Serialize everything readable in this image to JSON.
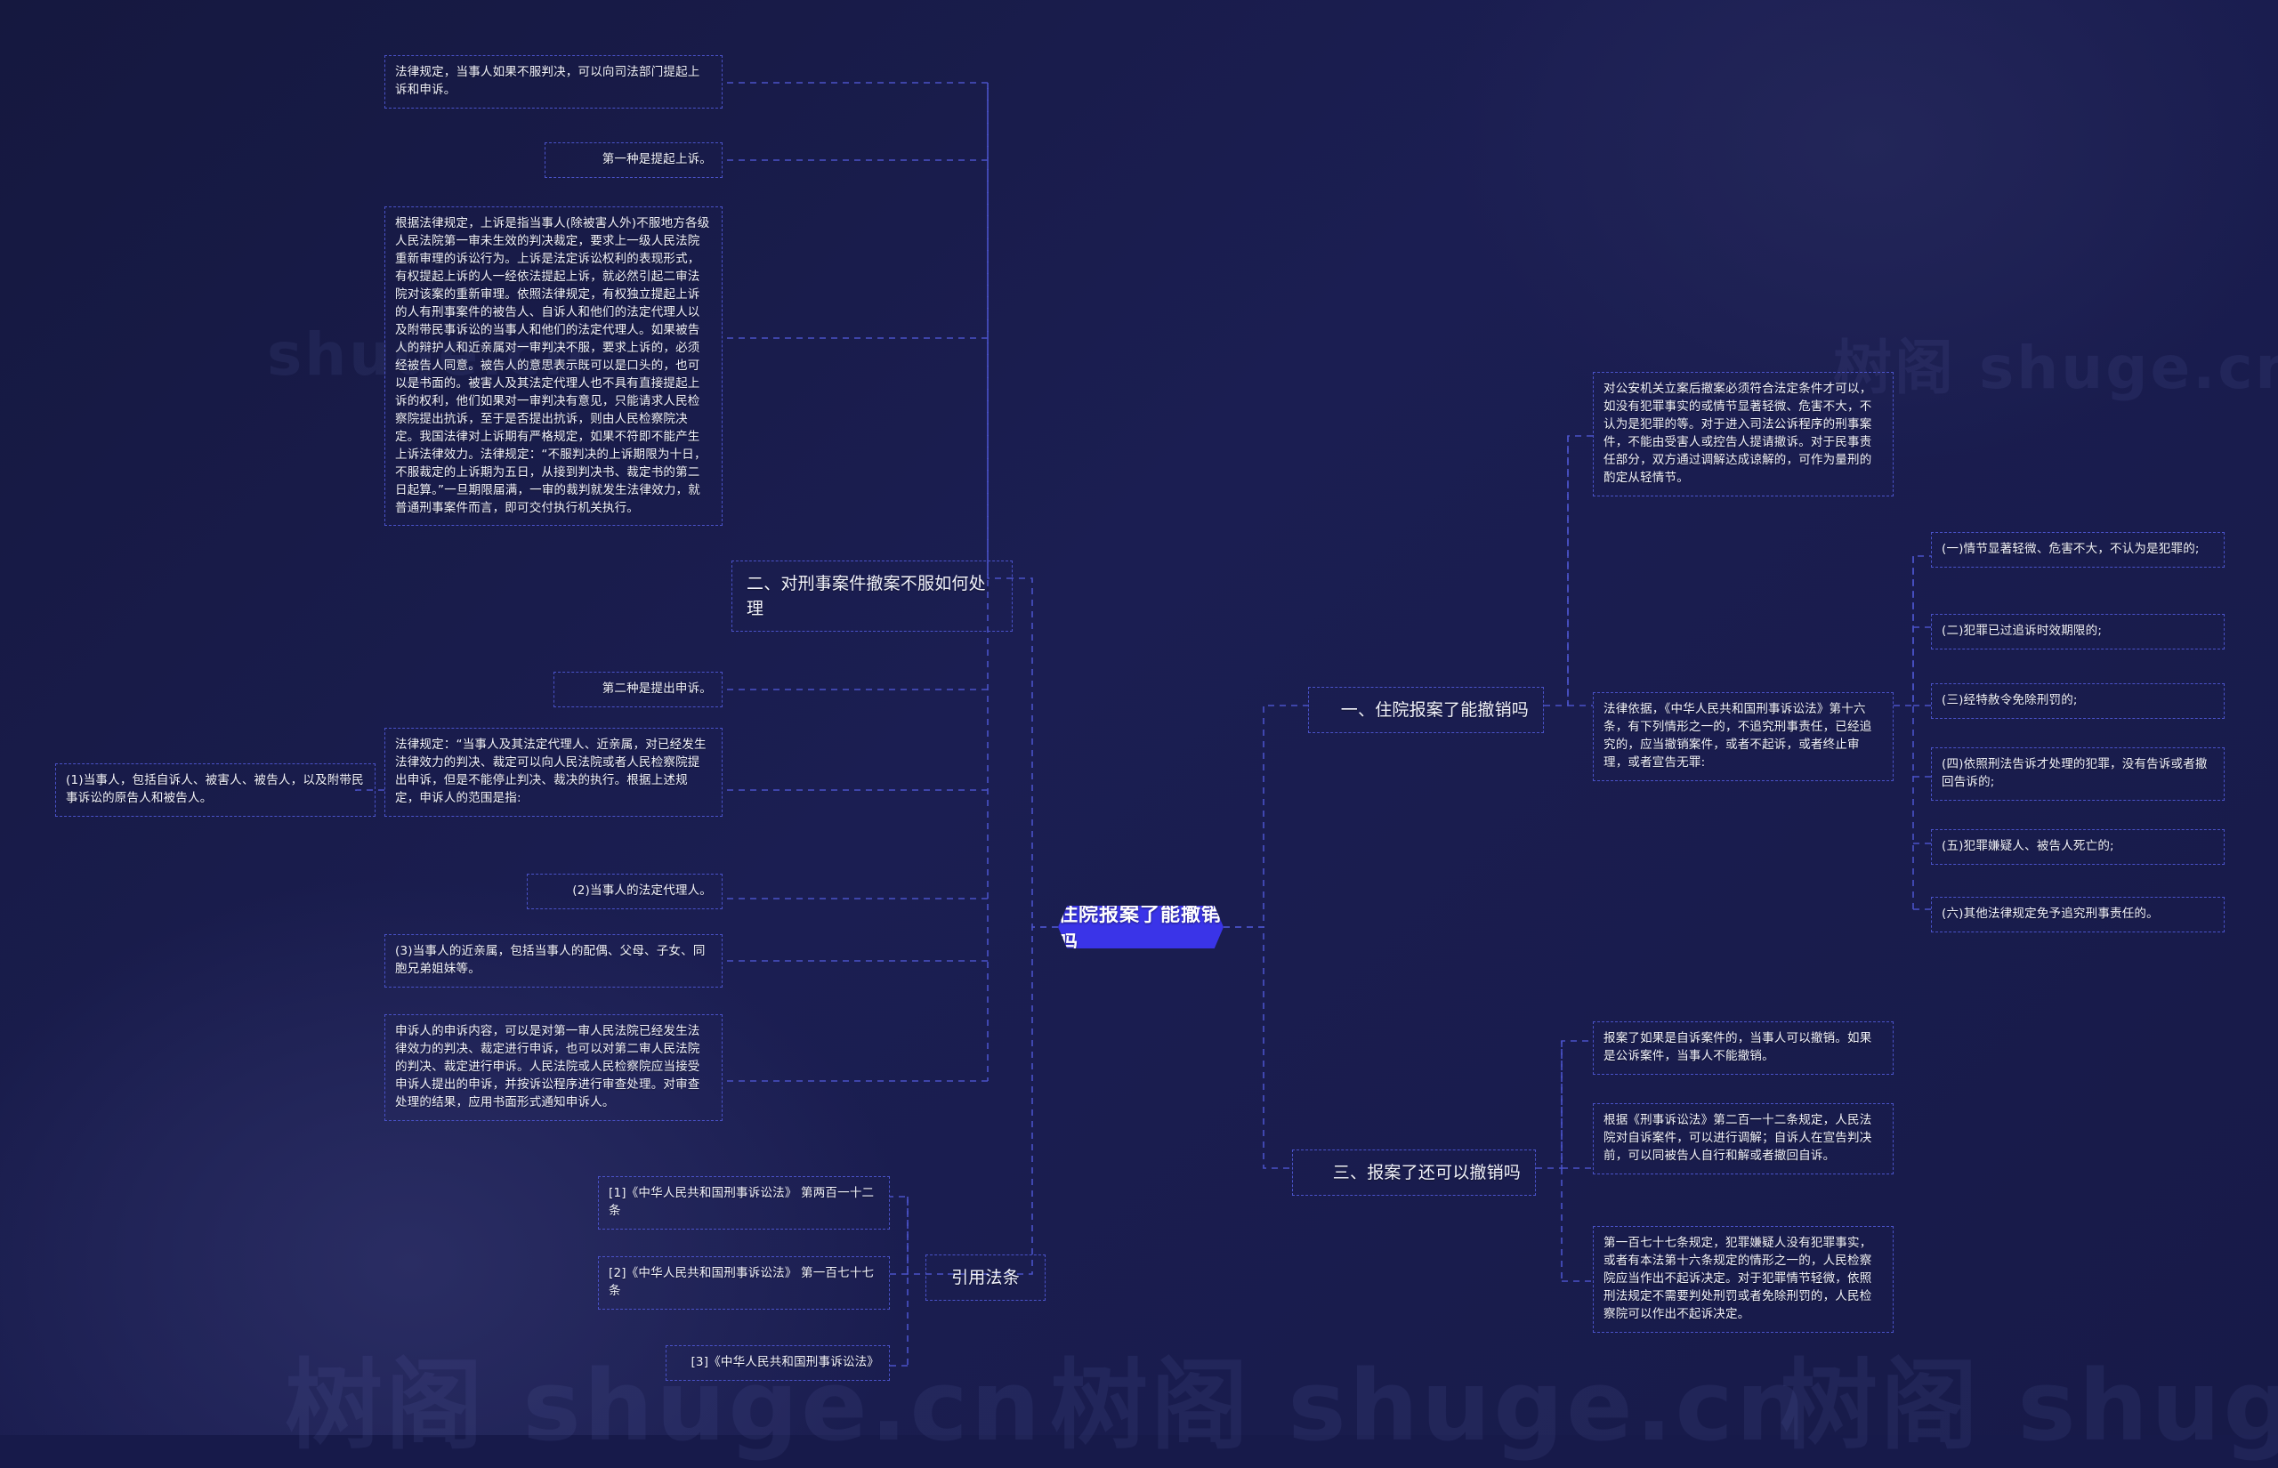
{
  "root": {
    "label": "住院报案了能撤销吗"
  },
  "theme": {
    "background": "#171a4a",
    "root_fill": "#3a34e8",
    "node_border": "#4a52c8",
    "text": "#f2f3fb"
  },
  "watermarks": [
    "树阁 shuge.cn",
    "树阁 shuge.cn",
    "树阁 shuge.cn",
    "shuge.cn",
    "树阁 shuge.cn"
  ],
  "branches": [
    {
      "id": "branch-1",
      "label": "一、住院报案了能撤销吗"
    },
    {
      "id": "branch-2",
      "label": "二、对刑事案件撤案不服如何处理"
    },
    {
      "id": "branch-3",
      "label": "三、报案了还可以撤销吗"
    },
    {
      "id": "branch-4",
      "label": "引用法条"
    }
  ],
  "nodes": {
    "n_top_intro": "法律规定，当事人如果不服判决，可以向司法部门提起上诉和申诉。",
    "n_first_kind": "第一种是提起上诉。",
    "n_appeal_body": "根据法律规定，上诉是指当事人(除被害人外)不服地方各级人民法院第一审未生效的判决裁定，要求上一级人民法院重新审理的诉讼行为。上诉是法定诉讼权利的表现形式，有权提起上诉的人一经依法提起上诉，就必然引起二审法院对该案的重新审理。依照法律规定，有权独立提起上诉的人有刑事案件的被告人、自诉人和他们的法定代理人以及附带民事诉讼的当事人和他们的法定代理人。如果被告人的辩护人和近亲属对一审判决不服，要求上诉的，必须经被告人同意。被告人的意思表示既可以是口头的，也可以是书面的。被害人及其法定代理人也不具有直接提起上诉的权利，他们如果对一审判决有意见，只能请求人民检察院提出抗诉，至于是否提出抗诉，则由人民检察院决定。我国法律对上诉期有严格规定，如果不符即不能产生上诉法律效力。法律规定：“不服判决的上诉期限为十日，不服裁定的上诉期为五日，从接到判决书、裁定书的第二日起算。”一旦期限届满，一审的裁判就发生法律效力，就普通刑事案件而言，即可交付执行机关执行。",
    "n_second_kind": "第二种是提出申诉。",
    "n_appeal2_body": "法律规定：“当事人及其法定代理人、近亲属，对已经发生法律效力的判决、裁定可以向人民法院或者人民检察院提出申诉，但是不能停止判决、裁决的执行。根据上述规定，申诉人的范围是指:",
    "n_party_1": "(1)当事人，包括自诉人、被害人、被告人，以及附带民事诉讼的原告人和被告人。",
    "n_party_2": "(2)当事人的法定代理人。",
    "n_party_3": "(3)当事人的近亲属，包括当事人的配偶、父母、子女、同胞兄弟姐妹等。",
    "n_appeal_content": "申诉人的申诉内容，可以是对第一审人民法院已经发生法律效力的判决、裁定进行申诉，也可以对第二审人民法院的判决、裁定进行申诉。人民法院或人民检察院应当接受申诉人提出的申诉，并按诉讼程序进行审查处理。对审查处理的结果，应用书面形式通知申诉人。",
    "n_cite_1": "[1]《中华人民共和国刑事诉讼法》 第两百一十二条",
    "n_cite_2": "[2]《中华人民共和国刑事诉讼法》 第一百七十七条",
    "n_cite_3": "[3]《中华人民共和国刑事诉讼法》",
    "n_police_withdraw": "对公安机关立案后撤案必须符合法定条件才可以，如没有犯罪事实的或情节显著轻微、危害不大，不认为是犯罪的等。对于进入司法公诉程序的刑事案件，不能由受害人或控告人提请撤诉。对于民事责任部分，双方通过调解达成谅解的，可作为量刑的酌定从轻情节。",
    "n_legal_basis": "法律依据，《中华人民共和国刑事诉讼法》第十六条，有下列情形之一的，不追究刑事责任，已经追究的，应当撤销案件，或者不起诉，或者终止审理，或者宣告无罪:",
    "n_item_1": "(一)情节显著轻微、危害不大，不认为是犯罪的;",
    "n_item_2": "(二)犯罪已过追诉时效期限的;",
    "n_item_3": "(三)经特赦令免除刑罚的;",
    "n_item_4": "(四)依照刑法告诉才处理的犯罪，没有告诉或者撤回告诉的;",
    "n_item_5": "(五)犯罪嫌疑人、被告人死亡的;",
    "n_item_6": "(六)其他法律规定免予追究刑事责任的。",
    "n_self_case": "报案了如果是自诉案件的，当事人可以撤销。如果是公诉案件，当事人不能撤销。",
    "n_art212": "根据《刑事诉讼法》第二百一十二条规定，人民法院对自诉案件，可以进行调解；自诉人在宣告判决前，可以同被告人自行和解或者撤回自诉。",
    "n_art177": "第一百七十七条规定，犯罪嫌疑人没有犯罪事实，或者有本法第十六条规定的情形之一的，人民检察院应当作出不起诉决定。对于犯罪情节轻微，依照刑法规定不需要判处刑罚或者免除刑罚的，人民检察院可以作出不起诉决定。"
  }
}
